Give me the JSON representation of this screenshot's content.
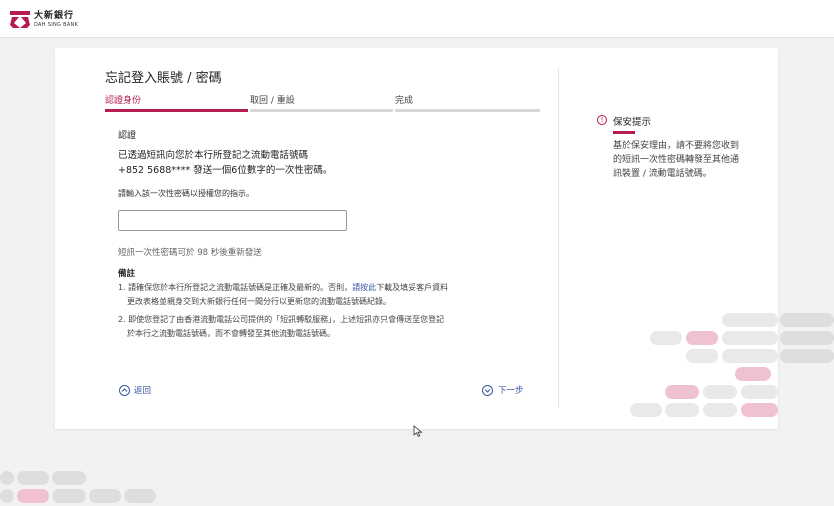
{
  "brand": {
    "name_zh": "大新銀行",
    "name_en": "DAH SING BANK",
    "accent": "#b61d4f",
    "link_color": "#3a57a6"
  },
  "page": {
    "title": "忘記登入賬號 / 密碼"
  },
  "steps": [
    {
      "label": "認證身份",
      "active": true
    },
    {
      "label": "取回 / 重設",
      "active": false
    },
    {
      "label": "完成",
      "active": false
    }
  ],
  "verify": {
    "section_title": "認證",
    "line1": "已透過短訊向您於本行所登記之流動電話號碼",
    "line2": "+852 5688**** 發送一個6位數字的一次性密碼。",
    "instruction": "請輸入該一次性密碼以授權您的指示。",
    "otp_value": "",
    "resend_text": "短訊一次性密碼可於 98 秒後重新發送"
  },
  "notes": {
    "title": "備註",
    "n1_a": "1. 請確保您於本行所登記之流動電話號碼是正確及最新的。否則，",
    "n1_link": "請按此",
    "n1_b": "下載及填妥客戶資料",
    "n1_c": "更改表格並親身交到大新銀行任何一間分行以更新您的流動電話號碼紀錄。",
    "n2_a": "2. 即使您登記了由香港流動電話公司提供的「短訊轉駁服務」，上述短訊亦只會傳送至您登記",
    "n2_b": "於本行之流動電話號碼，而不會轉發至其他流動電話號碼。"
  },
  "nav": {
    "back_label": "返回",
    "next_label": "下一步"
  },
  "tips": {
    "title": "保安提示",
    "text": "基於保安理由，請不要將您收到的短訊一次性密碼轉發至其他通訊裝置 / 流動電話號碼。"
  }
}
